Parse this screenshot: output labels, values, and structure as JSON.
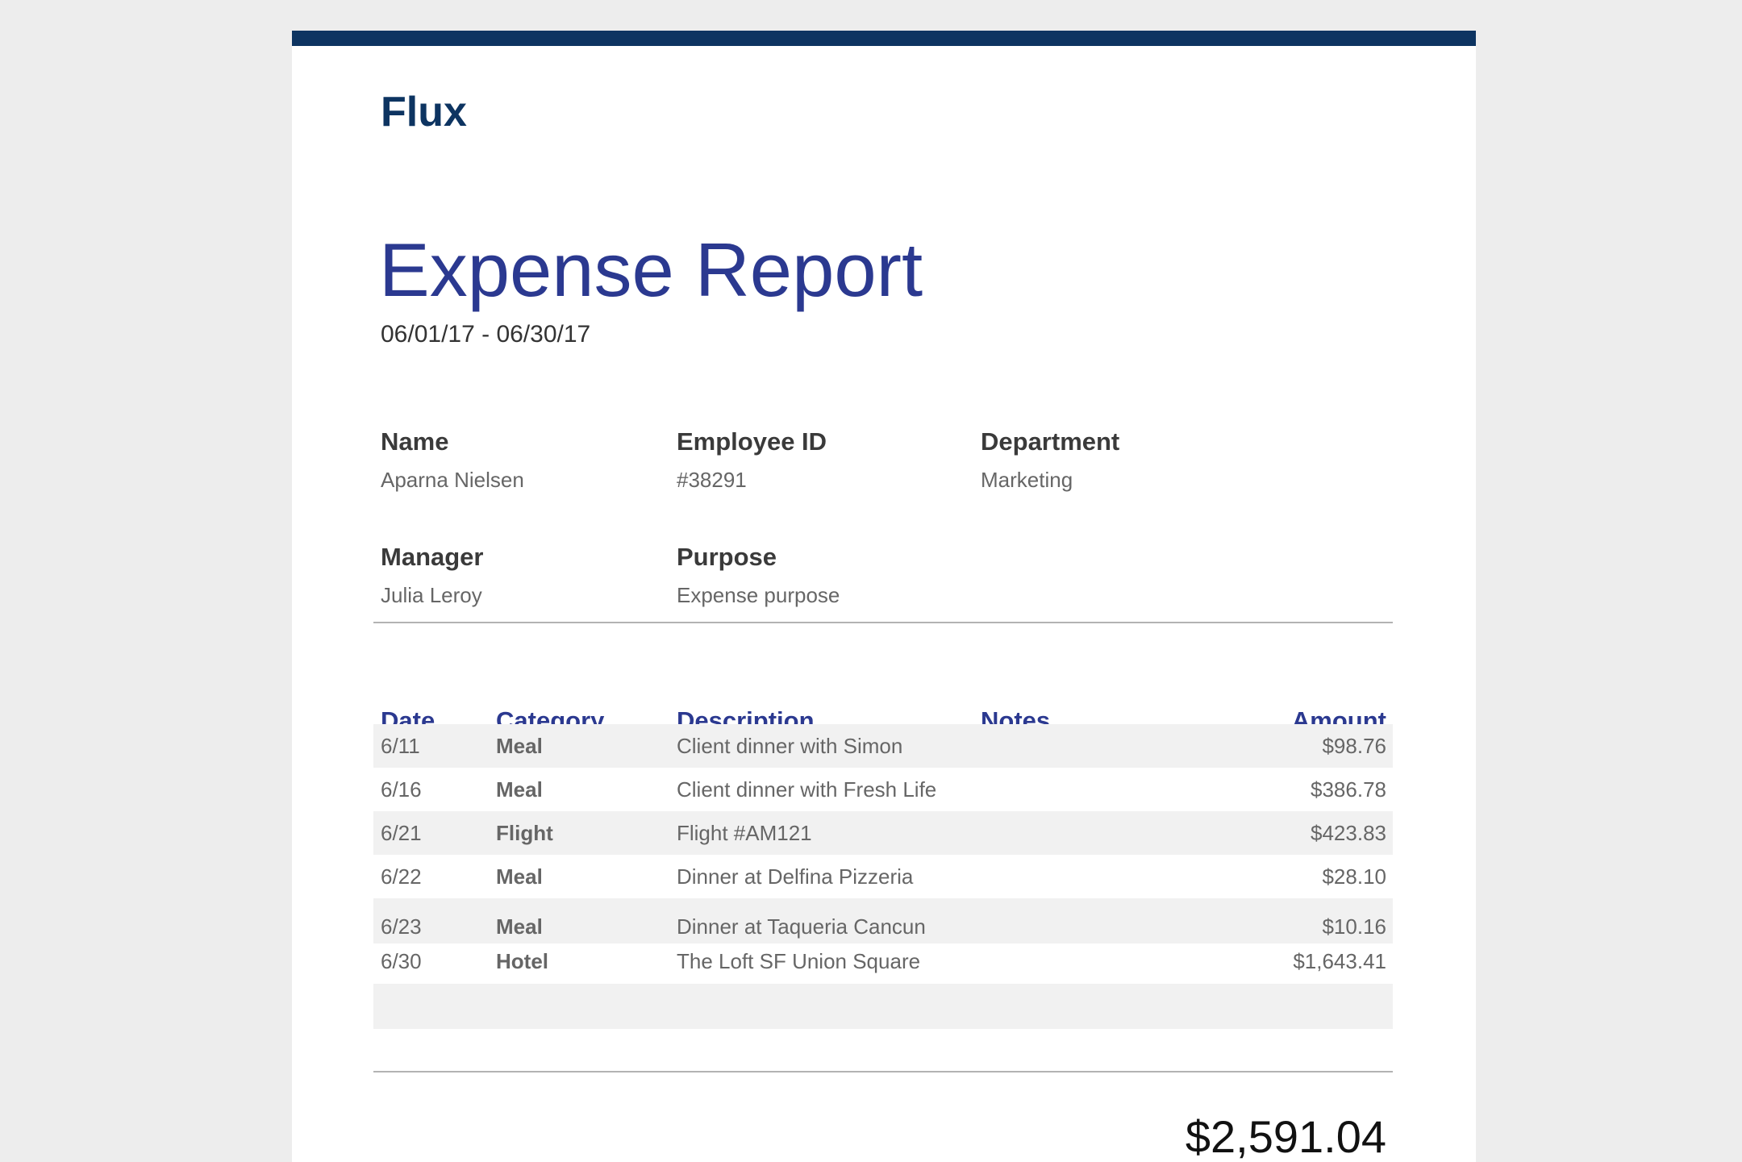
{
  "brand": "Flux",
  "title": "Expense Report",
  "period": "06/01/17 - 06/30/17",
  "fields": {
    "name": {
      "label": "Name",
      "value": "Aparna Nielsen"
    },
    "employee_id": {
      "label": "Employee ID",
      "value": "#38291"
    },
    "department": {
      "label": "Department",
      "value": "Marketing"
    },
    "manager": {
      "label": "Manager",
      "value": "Julia Leroy"
    },
    "purpose": {
      "label": "Purpose",
      "value": "Expense purpose"
    }
  },
  "table": {
    "headers": {
      "date": "Date",
      "category": "Category",
      "description": "Description",
      "notes": "Notes",
      "amount": "Amount"
    },
    "rows": [
      {
        "date": "6/11",
        "category": "Meal",
        "description": "Client dinner with Simon",
        "notes": "",
        "amount": "$98.76"
      },
      {
        "date": "6/16",
        "category": "Meal",
        "description": "Client dinner with Fresh Life",
        "notes": "",
        "amount": "$386.78"
      },
      {
        "date": "6/21",
        "category": "Flight",
        "description": "Flight #AM121",
        "notes": "",
        "amount": "$423.83"
      },
      {
        "date": "6/22",
        "category": "Meal",
        "description": "Dinner at Delfina Pizzeria",
        "notes": "",
        "amount": "$28.10"
      },
      {
        "date": "6/23",
        "category": "Meal",
        "description": "Dinner at Taqueria Cancun",
        "notes": "",
        "amount": "$10.16"
      },
      {
        "date": "6/30",
        "category": "Hotel",
        "description": "The Loft SF Union Square",
        "notes": "",
        "amount": "$1,643.41"
      }
    ]
  },
  "total": "$2,591.04",
  "colors": {
    "brand": "#0d3461",
    "accent": "#2b3990",
    "row_shade": "#f1f1f1"
  }
}
